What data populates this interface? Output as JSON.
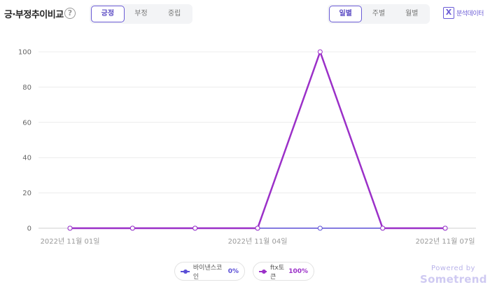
{
  "header": {
    "title": "긍·부정추이비교",
    "help_icon": "?",
    "sentiment_tabs": [
      {
        "label": "긍정",
        "active": true
      },
      {
        "label": "부정",
        "active": false
      },
      {
        "label": "중립",
        "active": false
      }
    ],
    "period_tabs": [
      {
        "label": "일별",
        "active": true
      },
      {
        "label": "주별",
        "active": false
      },
      {
        "label": "월별",
        "active": false
      }
    ],
    "export_icon": "excel-icon",
    "export_glyph": "X",
    "export_label": "분석데이터"
  },
  "chart_data": {
    "type": "line",
    "x": [
      "2022년 11월 01일",
      "2022년 11월 02일",
      "2022년 11월 03일",
      "2022년 11월 04일",
      "2022년 11월 05일",
      "2022년 11월 06일",
      "2022년 11월 07일"
    ],
    "x_tick_labels": [
      "2022년 11월 01일",
      "2022년 11월 04일",
      "2022년 11월 07일"
    ],
    "y_ticks": [
      0,
      20,
      40,
      60,
      80,
      100
    ],
    "ylim": [
      0,
      100
    ],
    "grid": true,
    "series": [
      {
        "name": "바이낸스코인",
        "color": "#5b4fd6",
        "values": [
          0,
          0,
          0,
          0,
          0,
          0,
          0
        ]
      },
      {
        "name": "ftx토큰",
        "color": "#9b30c8",
        "values": [
          0,
          0,
          0,
          0,
          100,
          0,
          0
        ]
      }
    ]
  },
  "legend": [
    {
      "name": "바이낸스코인",
      "pct": "0%",
      "color": "#5b4fd6"
    },
    {
      "name": "ftx토큰",
      "pct": "100%",
      "color": "#9b30c8"
    }
  ],
  "footer": {
    "powered_by": "Powered by",
    "brand": "Sometrend"
  }
}
